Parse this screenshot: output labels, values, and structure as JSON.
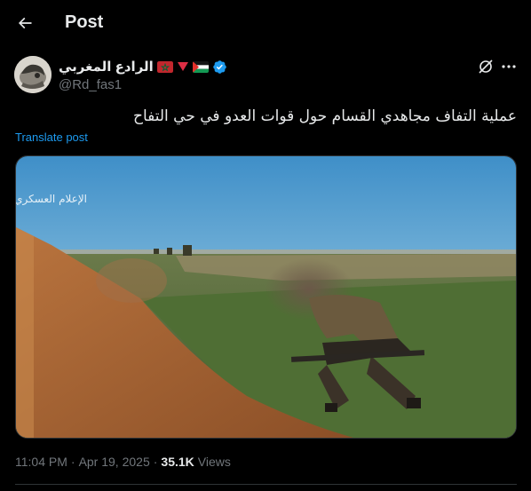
{
  "header": {
    "title": "Post"
  },
  "author": {
    "display_name": "الرادع المغربي",
    "handle": "@Rd_fas1",
    "verified": true,
    "flags": [
      "morocco-flag",
      "red-triangle",
      "palestine-flag"
    ]
  },
  "post": {
    "text": "عملية التفاف مجاهدي القسام حول قوات العدو في حي التفاح",
    "translate_label": "Translate post",
    "media_watermark": "الإعلام العسكري"
  },
  "meta": {
    "time": "11:04 PM",
    "date": "Apr 19, 2025",
    "separator": "·",
    "views_count": "35.1K",
    "views_label": "Views"
  },
  "colors": {
    "background": "#000000",
    "text": "#e7e9ea",
    "secondary": "#71767b",
    "accent": "#1d9bf0",
    "border": "#2f3336"
  },
  "icons": [
    "back-arrow-icon",
    "verified-badge-icon",
    "grok-icon",
    "more-icon"
  ]
}
